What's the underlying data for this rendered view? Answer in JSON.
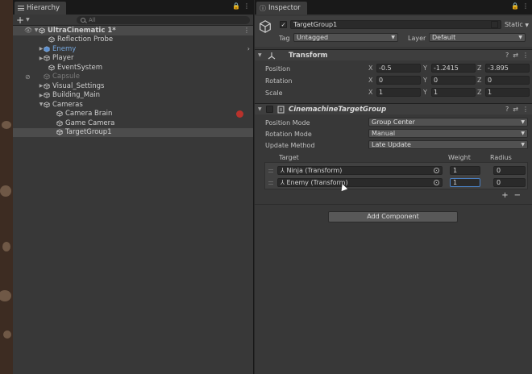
{
  "hierarchy": {
    "tab_label": "Hierarchy",
    "search_placeholder": "All",
    "add_symbol": "+",
    "lock_symbol": "🔒",
    "menu_symbol": "⋮",
    "items": [
      {
        "label": "UltraCinematic 1*",
        "style": "root"
      },
      {
        "label": "Reflection Probe",
        "style": "normal"
      },
      {
        "label": "Enemy",
        "style": "blue"
      },
      {
        "label": "Player",
        "style": "normal"
      },
      {
        "label": "EventSystem",
        "style": "normal"
      },
      {
        "label": "Capsule",
        "style": "dim"
      },
      {
        "label": "Visual_Settings",
        "style": "normal"
      },
      {
        "label": "Building_Main",
        "style": "normal"
      },
      {
        "label": "Cameras",
        "style": "normal"
      },
      {
        "label": "Camera Brain",
        "style": "normal"
      },
      {
        "label": "Game Camera",
        "style": "normal"
      },
      {
        "label": "TargetGroup1",
        "style": "selected"
      }
    ]
  },
  "inspector": {
    "tab_label": "Inspector",
    "object_name": "TargetGroup1",
    "static_label": "Static",
    "tag_label": "Tag",
    "tag_value": "Untagged",
    "layer_label": "Layer",
    "layer_value": "Default",
    "transform": {
      "title": "Transform",
      "position_label": "Position",
      "rotation_label": "Rotation",
      "scale_label": "Scale",
      "axes": [
        "X",
        "Y",
        "Z"
      ],
      "position": [
        "-0.5",
        "-1.2415",
        "-3.895"
      ],
      "rotation": [
        "0",
        "0",
        "0"
      ],
      "scale": [
        "1",
        "1",
        "1"
      ]
    },
    "target_group": {
      "title": "CinemachineTargetGroup",
      "position_mode_label": "Position Mode",
      "position_mode_value": "Group Center",
      "rotation_mode_label": "Rotation Mode",
      "rotation_mode_value": "Manual",
      "update_method_label": "Update Method",
      "update_method_value": "Late Update",
      "col_target": "Target",
      "col_weight": "Weight",
      "col_radius": "Radius",
      "targets": [
        {
          "name": "Ninja (Transform)",
          "weight": "1",
          "radius": "0"
        },
        {
          "name": "Enemy (Transform)",
          "weight": "1",
          "radius": "0"
        }
      ],
      "plus": "+",
      "minus": "−"
    },
    "add_component_label": "Add Component"
  },
  "colors": {
    "panel_bg": "#383838",
    "selected_row": "#4c4c4c",
    "prefab_blue": "#76a7dd",
    "focus_blue": "#4a80c4",
    "record_red": "#b8322c"
  }
}
